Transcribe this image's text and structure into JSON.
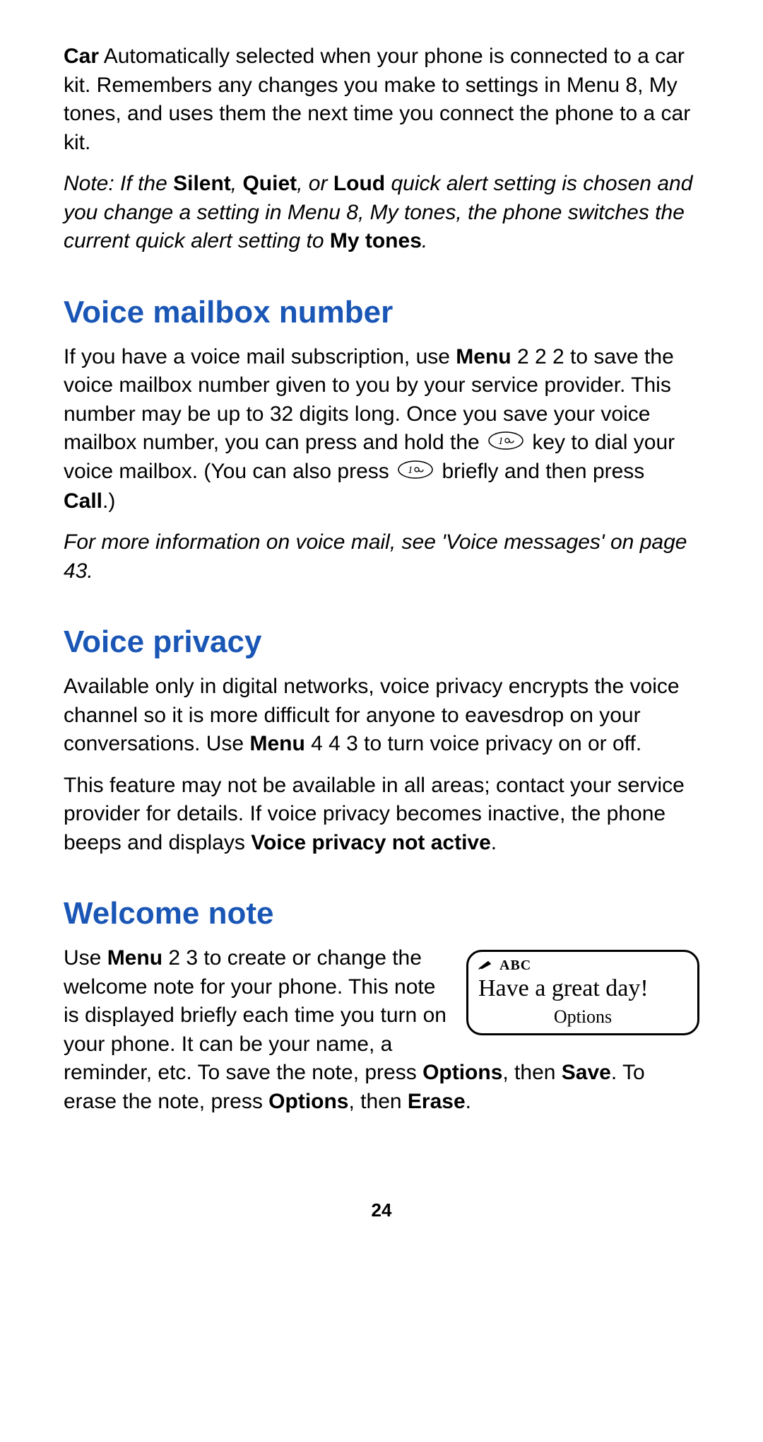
{
  "car_paragraph": {
    "label": "Car",
    "text": "  Automatically selected when your phone is connected to a car kit. Remembers any changes you make to settings in Menu 8, My tones, and uses them the next time you connect the phone to a car kit."
  },
  "note_paragraph": {
    "prefix": "Note:  If the ",
    "silent": "Silent",
    "sep1": ", ",
    "quiet": "Quiet",
    "sep2": ", or ",
    "loud": "Loud",
    "mid": " quick alert setting is chosen and you change a setting in Menu 8, My tones, the phone switches the current quick alert setting to ",
    "mytones": "My tones",
    "end": "."
  },
  "voice_mailbox": {
    "heading": "Voice mailbox number",
    "p1_a": "If you have a voice mail subscription, use ",
    "p1_menu": "Menu",
    "p1_b": " 2 2 2 to save the voice mailbox number given to you by your service provider. This number may be up to 32 digits long. Once you save your voice mailbox number, you can press and hold the ",
    "p1_c": " key to dial your voice mailbox. (You can also press ",
    "p1_d": " briefly and then press ",
    "p1_call": "Call",
    "p1_e": ".)",
    "p2": "For more information on voice mail, see 'Voice messages' on page 43."
  },
  "voice_privacy": {
    "heading": "Voice privacy",
    "p1_a": "Available only in digital networks, voice privacy encrypts the voice channel so it is more difficult for anyone to eavesdrop on your conversations. Use ",
    "p1_menu": "Menu",
    "p1_b": " 4 4 3 to turn voice privacy on or off.",
    "p2_a": "This feature may not be available in all areas; contact your service provider for details. If voice privacy becomes inactive, the phone beeps and displays ",
    "p2_bold": "Voice privacy not active",
    "p2_b": "."
  },
  "welcome_note": {
    "heading": "Welcome note",
    "p1_a": "Use ",
    "p1_menu": "Menu",
    "p1_b": " 2 3 to create or change the welcome note for your phone. This note is displayed briefly each time you turn on your phone. It can be your name, a reminder, etc. To save the note, press ",
    "p1_options": "Options",
    "p1_c": ", then ",
    "p1_save": "Save",
    "p1_d": ". To erase the note, press ",
    "p1_options2": "Options",
    "p1_e": ", then ",
    "p1_erase": "Erase",
    "p1_f": "."
  },
  "phone_screen": {
    "mode": "ABC",
    "message": "Have a great day!",
    "softkey": "Options"
  },
  "page_number": "24"
}
